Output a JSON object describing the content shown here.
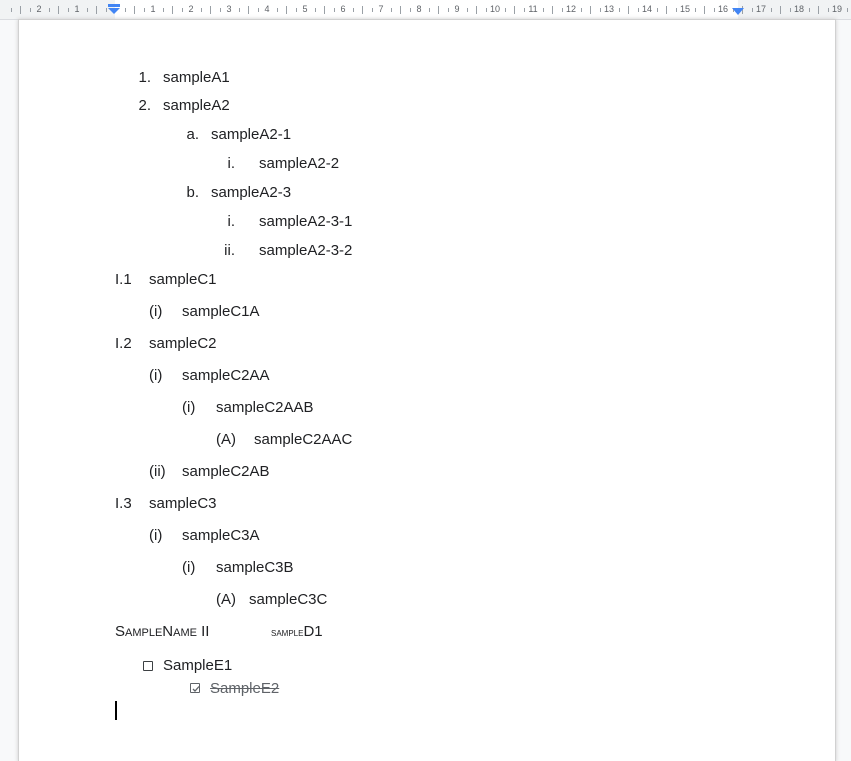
{
  "ruler": {
    "numbers": [
      "2",
      "1",
      "1",
      "2",
      "3",
      "4",
      "5",
      "6",
      "7",
      "8",
      "9",
      "10",
      "11",
      "12",
      "13",
      "14",
      "15",
      "16",
      "17",
      "18",
      "19"
    ]
  },
  "document": {
    "list_a": [
      {
        "marker": "1.",
        "text": "sampleA1"
      },
      {
        "marker": "2.",
        "text": "sampleA2"
      },
      {
        "marker": "a.",
        "text": "sampleA2-1"
      },
      {
        "marker": "i.",
        "text": "sampleA2-2"
      },
      {
        "marker": "b.",
        "text": "sampleA2-3"
      },
      {
        "marker": "i.",
        "text": "sampleA2-3-1"
      },
      {
        "marker": "ii.",
        "text": "sampleA2-3-2"
      }
    ],
    "list_c": [
      {
        "marker": "I.1",
        "text": "sampleC1"
      },
      {
        "marker": "(i)",
        "text": "sampleC1A"
      },
      {
        "marker": "I.2",
        "text": "sampleC2"
      },
      {
        "marker": "(i)",
        "text": "sampleC2AA"
      },
      {
        "marker": "(i)",
        "text": "sampleC2AAB"
      },
      {
        "marker": "(A)",
        "text": "sampleC2AAC"
      },
      {
        "marker": "(ii)",
        "text": "sampleC2AB"
      },
      {
        "marker": "I.3",
        "text": "sampleC3"
      },
      {
        "marker": "(i)",
        "text": "sampleC3A"
      },
      {
        "marker": "(i)",
        "text": "sampleC3B"
      },
      {
        "marker": "(A)",
        "text": "sampleC3C"
      }
    ],
    "smallcaps_line": {
      "part1": "SampleName II",
      "part2": "sample",
      "part3": "D1"
    },
    "checklist": [
      {
        "text": "SampleE1",
        "checked": false
      },
      {
        "text": "SampleE2",
        "checked": true
      }
    ]
  }
}
